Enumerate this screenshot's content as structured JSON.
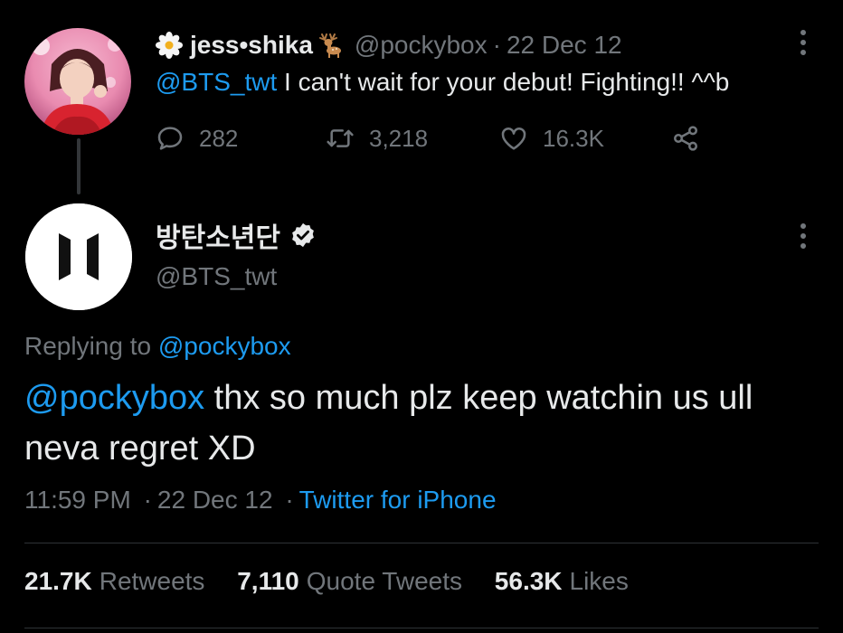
{
  "parent_tweet": {
    "display_name": "jess•shika",
    "handle": "@pockybox",
    "separator": "·",
    "date": "22 Dec 12",
    "mention": "@BTS_twt",
    "text": " I can't wait for your debut! Fighting!! ^^b",
    "replies": "282",
    "retweets": "3,218",
    "likes": "16.3K",
    "icons": [
      "flower-icon",
      "deer-icon",
      "more-icon",
      "reply-icon",
      "retweet-icon",
      "like-icon",
      "share-icon"
    ]
  },
  "main_tweet": {
    "display_name": "방탄소년단",
    "handle": "@BTS_twt",
    "replying_prefix": "Replying to ",
    "replying_handle": "@pockybox",
    "mention": "@pockybox",
    "text": " thx so much plz keep watchin us ull neva regret XD",
    "time": "11:59 PM",
    "date": "22 Dec 12",
    "separator": "·",
    "source": "Twitter for iPhone",
    "stats": {
      "retweets_count": "21.7K",
      "retweets_label": "Retweets",
      "quotes_count": "7,110",
      "quotes_label": "Quote Tweets",
      "likes_count": "56.3K",
      "likes_label": "Likes"
    },
    "icons": [
      "bts-logo-icon",
      "verified-icon",
      "more-icon"
    ]
  },
  "colors": {
    "background": "#000000",
    "text": "#e7e9ea",
    "muted": "#71767b",
    "link": "#1d9bf0",
    "divider": "#2f3336"
  }
}
